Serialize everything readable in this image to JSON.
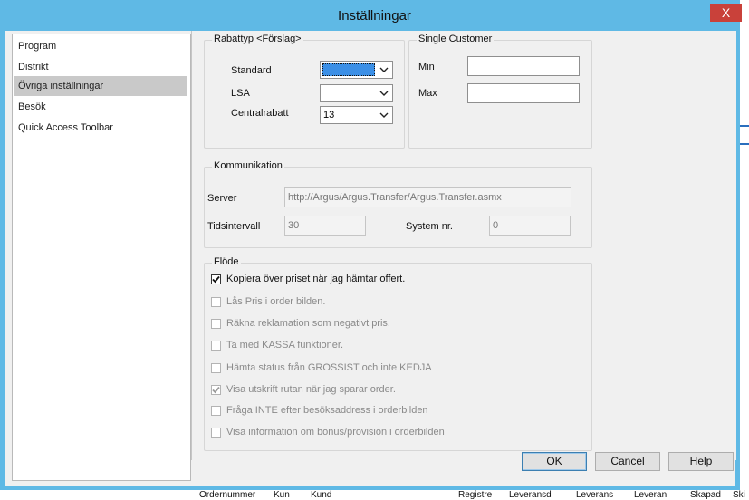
{
  "window": {
    "title": "Inställningar",
    "close_glyph": "X"
  },
  "background_app": {
    "columns": [
      "Ordernummer",
      "Kun",
      "Kund",
      "Registre",
      "Leveransd",
      "Leverans",
      "Leveran",
      "Skapad",
      "Ski"
    ]
  },
  "nav": {
    "items": [
      {
        "label": "Program"
      },
      {
        "label": "Distrikt"
      },
      {
        "label": "Övriga inställningar",
        "selected": true
      },
      {
        "label": "Besök"
      },
      {
        "label": "Quick Access Toolbar"
      }
    ]
  },
  "rabattyp": {
    "title": "Rabattyp <Förslag>",
    "standard_label": "Standard",
    "standard_value": "",
    "lsa_label": "LSA",
    "lsa_value": "",
    "central_label": "Centralrabatt",
    "central_value": "13"
  },
  "single_customer": {
    "title": "Single Customer",
    "min_label": "Min",
    "min_value": "",
    "max_label": "Max",
    "max_value": ""
  },
  "kommunikation": {
    "title": "Kommunikation",
    "server_label": "Server",
    "server_value": "http://Argus/Argus.Transfer/Argus.Transfer.asmx",
    "interval_label": "Tidsintervall",
    "interval_value": "30",
    "system_label": "System nr.",
    "system_value": "0"
  },
  "flode": {
    "title": "Flöde",
    "options": [
      {
        "label": "Kopiera över priset när jag hämtar offert.",
        "checked": true,
        "enabled": true
      },
      {
        "label": "Lås Pris i order bilden.",
        "checked": false,
        "enabled": false
      },
      {
        "label": "Räkna reklamation som negativt pris.",
        "checked": false,
        "enabled": false
      },
      {
        "label": "Ta med KASSA funktioner.",
        "checked": false,
        "enabled": false
      },
      {
        "label": "Hämta status från GROSSIST och inte KEDJA",
        "checked": false,
        "enabled": false
      },
      {
        "label": "Visa utskrift rutan när jag sparar order.",
        "checked": true,
        "enabled": false
      },
      {
        "label": "Fråga INTE efter besöksaddress i orderbilden",
        "checked": false,
        "enabled": false
      },
      {
        "label": "Visa information om bonus/provision i orderbilden",
        "checked": false,
        "enabled": false
      }
    ]
  },
  "buttons": {
    "ok": "OK",
    "cancel": "Cancel",
    "help": "Help"
  },
  "colors": {
    "titlebar": "#5fb9e5",
    "close": "#c9413a",
    "selection": "#3b8fe6"
  }
}
